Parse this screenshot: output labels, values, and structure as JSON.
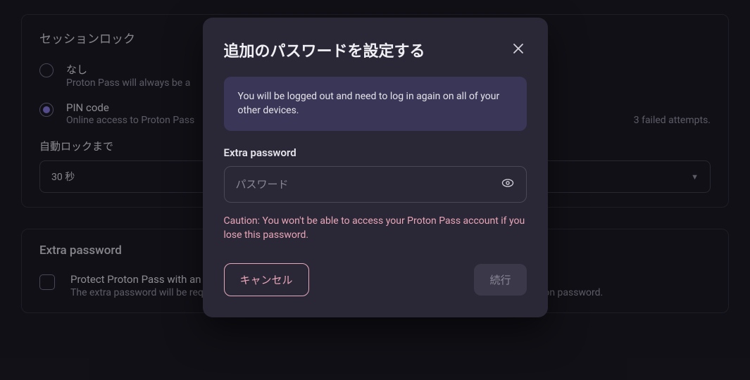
{
  "session_lock": {
    "title": "セッションロック",
    "options": [
      {
        "label": "なし",
        "desc": "Proton Pass will always be a",
        "selected": false
      },
      {
        "label": "PIN code",
        "desc_left": "Online access to Proton Pass",
        "desc_right": "3 failed attempts.",
        "selected": true
      }
    ],
    "auto_lock_label": "自動ロックまで",
    "auto_lock_value": "30 秒"
  },
  "extra_password": {
    "title": "Extra password",
    "toggle_label": "Protect Proton Pass with an extra password",
    "toggle_desc": "The extra password will be required to use Proton Pass. It acts as an additional password on top of your Proton password."
  },
  "modal": {
    "title": "追加のパスワードを設定する",
    "info": "You will be logged out and need to log in again on all of your other devices.",
    "field_label": "Extra password",
    "placeholder": "パスワード",
    "caution": "Caution: You won't be able to access your Proton Pass account if you lose this password.",
    "cancel": "キャンセル",
    "continue": "続行"
  }
}
